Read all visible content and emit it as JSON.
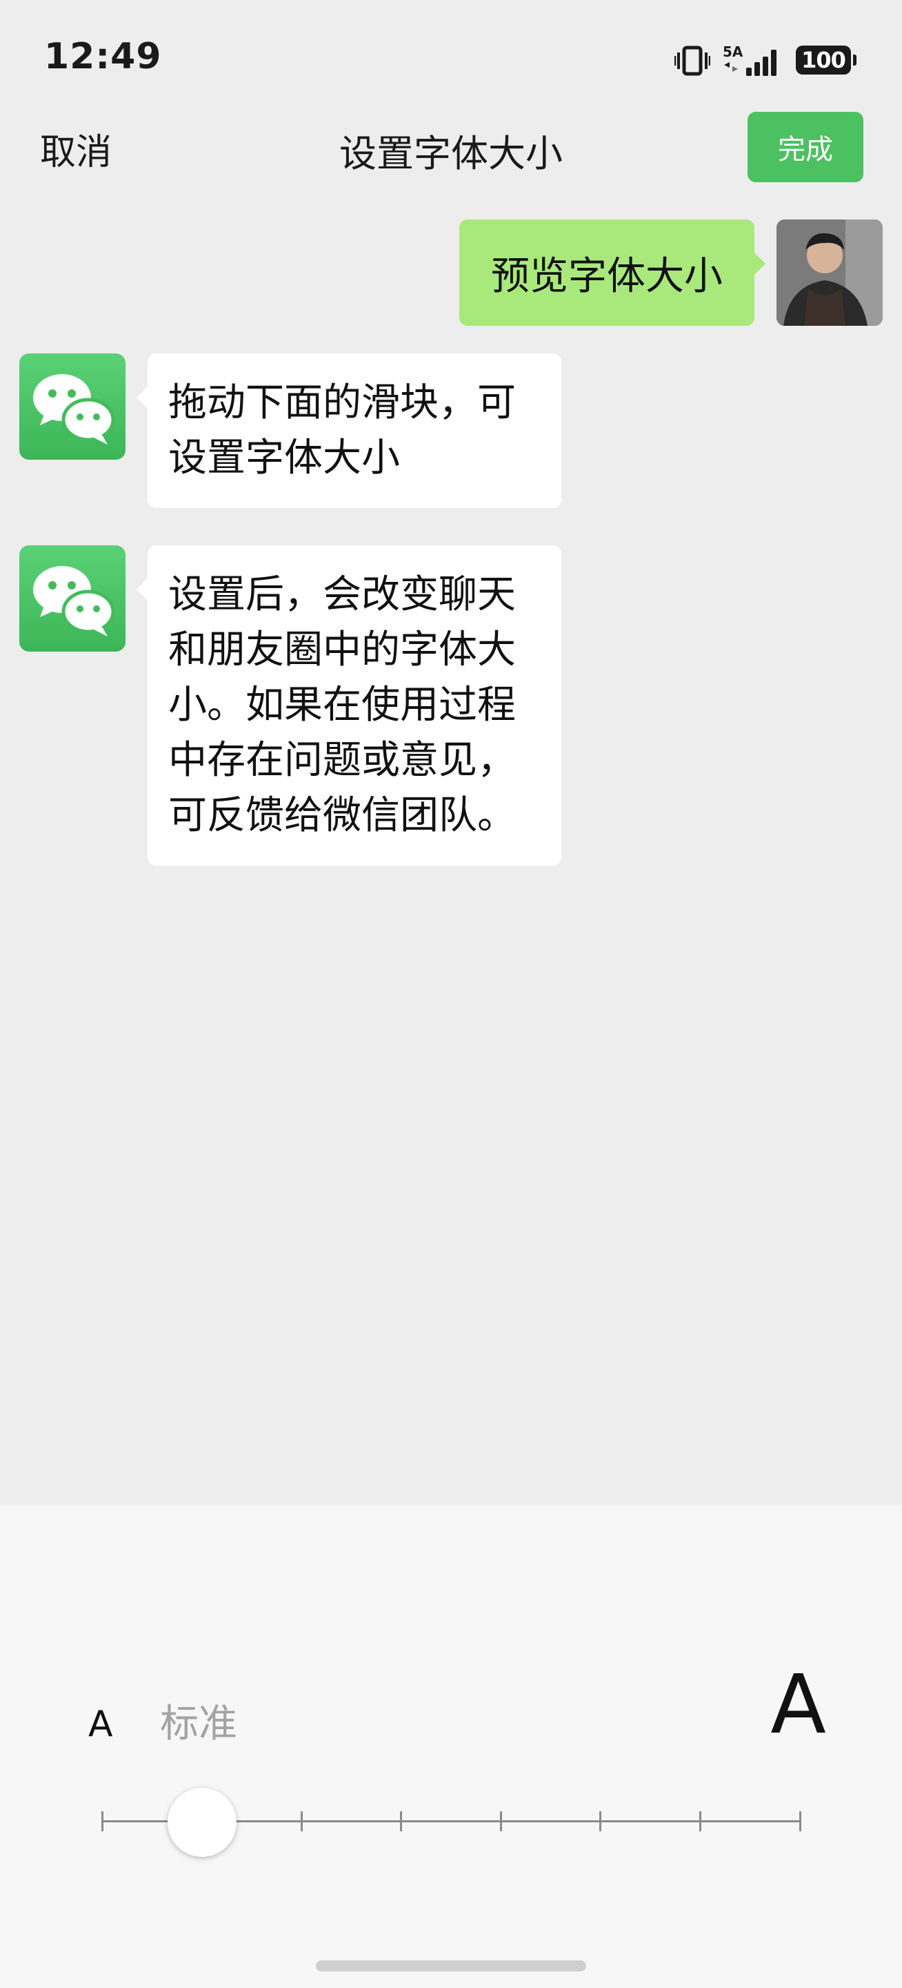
{
  "status_bar": {
    "time": "12:49",
    "network_label": "5A",
    "battery": "100",
    "icons": [
      "vibrate-icon",
      "signal-icon",
      "battery-icon"
    ]
  },
  "nav": {
    "cancel_label": "取消",
    "title": "设置字体大小",
    "done_label": "完成"
  },
  "messages": [
    {
      "direction": "outgoing",
      "sender_avatar": "user-avatar",
      "text": "预览字体大小"
    },
    {
      "direction": "incoming",
      "sender_avatar": "wechat-logo-icon",
      "text": "拖动下面的滑块，可设置字体大小"
    },
    {
      "direction": "incoming",
      "sender_avatar": "wechat-logo-icon",
      "text": "设置后，会改变聊天和朋友圈中的字体大小。如果在使用过程中存在问题或意见，可反馈给微信团队。"
    }
  ],
  "font_panel": {
    "small_label": "A",
    "current_size_label": "标准",
    "large_label": "A",
    "slider": {
      "steps": 8,
      "selected_index": 1
    }
  },
  "colors": {
    "background": "#ededed",
    "accent_green": "#4cc161",
    "outgoing_bubble": "#a9e97c",
    "incoming_bubble": "#ffffff",
    "panel_background": "#f7f7f7"
  }
}
